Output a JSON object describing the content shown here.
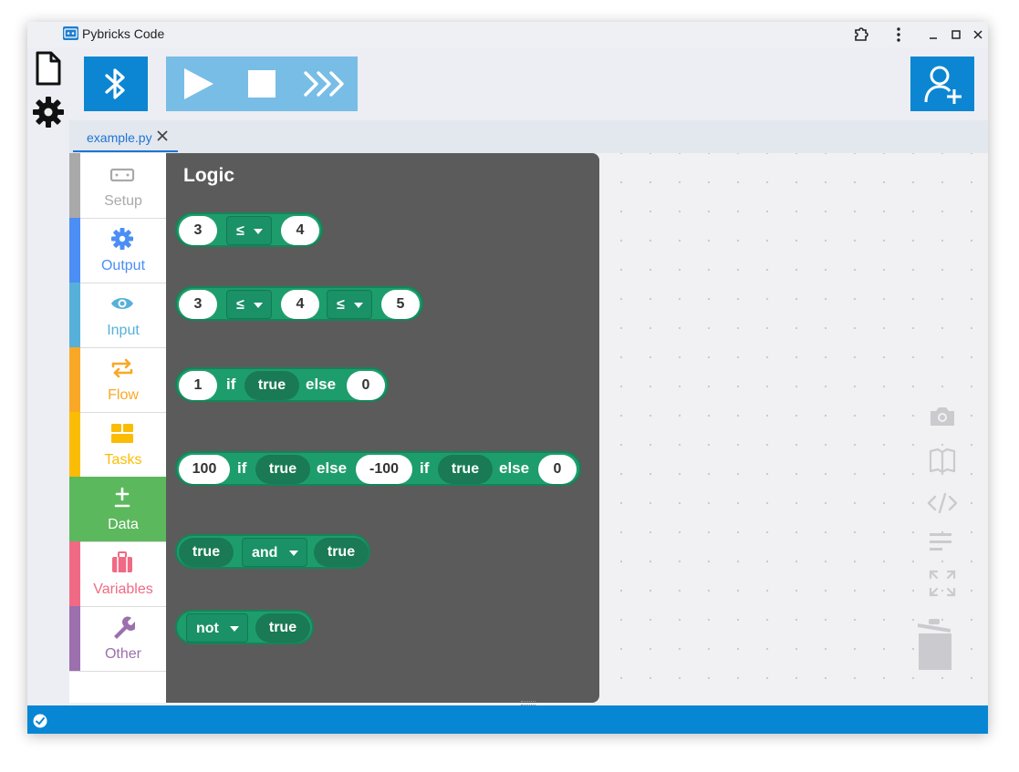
{
  "window": {
    "title": "Pybricks Code",
    "accent": "#0786d4"
  },
  "titlebar_controls": [
    "extensions-icon",
    "kebab-menu-icon",
    "minimize-icon",
    "maximize-icon",
    "close-icon"
  ],
  "toolbar": {
    "bluetooth": "bluetooth-icon",
    "run": "play-icon",
    "stop": "stop-icon",
    "repl": "repl-chevrons-icon",
    "sponsor": "add-user-icon"
  },
  "editor": {
    "tab_label": "example.py"
  },
  "categories": [
    {
      "label": "Setup",
      "color": "#a9a9a9"
    },
    {
      "label": "Output",
      "color": "#4b8ef5"
    },
    {
      "label": "Input",
      "color": "#56b0d9"
    },
    {
      "label": "Flow",
      "color": "#f9a825"
    },
    {
      "label": "Tasks",
      "color": "#fbbc05"
    },
    {
      "label": "Data",
      "color": "#5cb85c"
    },
    {
      "label": "Variables",
      "color": "#f06a85"
    },
    {
      "label": "Other",
      "color": "#9c6fae"
    }
  ],
  "flyout": {
    "title": "Logic",
    "block1": {
      "a": "3",
      "op": "≤",
      "b": "4"
    },
    "block2": {
      "a": "3",
      "op1": "≤",
      "b": "4",
      "op2": "≤",
      "c": "5"
    },
    "block3": {
      "value": "1",
      "kw_if": "if",
      "cond": "true",
      "kw_else": "else",
      "alt": "0"
    },
    "block4": {
      "value": "100",
      "kw_if": "if",
      "cond": "true",
      "kw_else": "else",
      "value2": "-100",
      "kw_if2": "if",
      "cond2": "true",
      "kw_else2": "else",
      "alt": "0"
    },
    "block5": {
      "a": "true",
      "op": "and",
      "b": "true"
    },
    "block6": {
      "op": "not",
      "a": "true"
    }
  },
  "workspace_tools": [
    "camera-icon",
    "book-icon",
    "code-icon",
    "align-left-icon",
    "fullscreen-icon",
    "trash-icon"
  ],
  "status": {
    "icon": "check-circle-icon"
  }
}
